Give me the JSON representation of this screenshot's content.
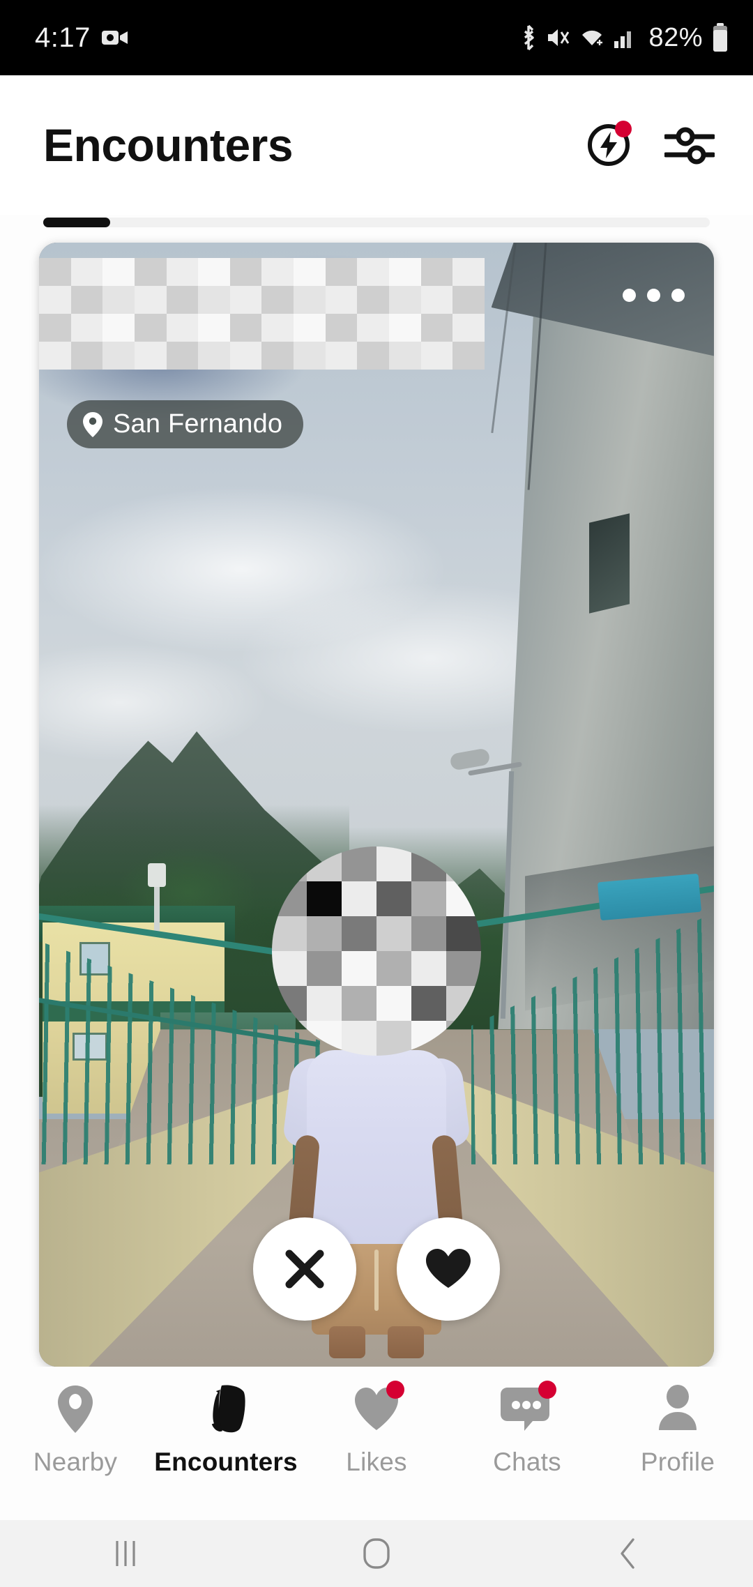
{
  "status_bar": {
    "time": "4:17",
    "battery_percent": "82%",
    "icons": [
      "video-camera-icon",
      "bluetooth-icon",
      "mute-icon",
      "wifi-icon",
      "cell-signal-icon",
      "battery-icon"
    ]
  },
  "header": {
    "title": "Encounters",
    "boost_icon": "lightning-bolt-circle-icon",
    "boost_has_badge": true,
    "filter_icon": "sliders-filter-icon",
    "badge_color": "#d50032"
  },
  "progress": {
    "value": 10,
    "fill_color": "#111111",
    "track_color": "#f1f1f1"
  },
  "card": {
    "location": "San Fernando",
    "location_icon": "map-pin-icon",
    "menu_icon": "three-dots-icon",
    "photo_description": "person in white t-shirt and tan shorts standing on a teal-railed bridge with mountain and cloudy sky",
    "censored_regions": [
      "top-banner-mosaic",
      "face-mosaic"
    ],
    "actions": [
      {
        "name": "pass",
        "icon": "x-close-icon"
      },
      {
        "name": "like",
        "icon": "heart-icon"
      }
    ]
  },
  "bottom_nav": {
    "items": [
      {
        "label": "Nearby",
        "icon": "map-pin-icon",
        "active": false,
        "badge": false
      },
      {
        "label": "Encounters",
        "icon": "stacked-cards-icon",
        "active": true,
        "badge": false
      },
      {
        "label": "Likes",
        "icon": "heart-icon",
        "active": false,
        "badge": true
      },
      {
        "label": "Chats",
        "icon": "chat-bubble-icon",
        "active": false,
        "badge": true
      },
      {
        "label": "Profile",
        "icon": "person-icon",
        "active": false,
        "badge": false
      }
    ],
    "active_color": "#111111",
    "inactive_color": "#9a9a9a",
    "badge_color": "#d50032"
  },
  "system_nav": {
    "recents_icon": "recents-bars-icon",
    "home_icon": "home-square-icon",
    "back_icon": "back-chevron-icon"
  }
}
